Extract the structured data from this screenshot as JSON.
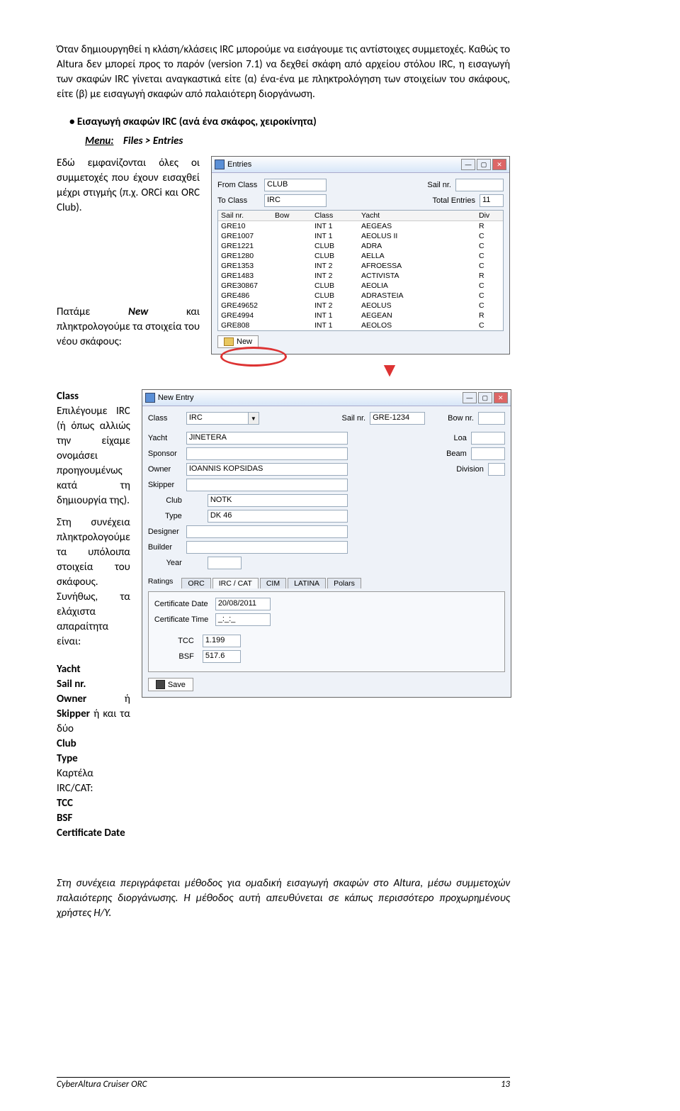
{
  "intro": {
    "p1": "Όταν δημιουργηθεί η κλάση/κλάσεις IRC μπορούμε να εισάγουμε τις αντίστοιχες συμμετοχές. Καθώς το Altura δεν μπορεί προς το παρόν (version 7.1) να δεχθεί σκάφη από αρχείου στόλου IRC, η εισαγωγή των σκαφών IRC γίνεται αναγκαστικά είτε (α) ένα-ένα με πληκτρολόγηση των στοιχείων του σκάφους, είτε (β) με εισαγωγή σκαφών από παλαιότερη διοργάνωση."
  },
  "section": {
    "bullet": "Εισαγωγή σκαφών IRC (ανά ένα σκάφος, χειροκίνητα)",
    "menu_pre": "Menu:",
    "menu_path": "Files > Entries",
    "desc1": "Εδώ εμφανίζονται όλες οι συμμετοχές που έχουν εισαχθεί μέχρι στιγμής (π.χ. ORCi και ORC Club).",
    "desc2_a": "Πατάμε ",
    "desc2_new": "New",
    "desc2_b": " και πληκτρολογούμε τα στοιχεία του νέου  σκάφους:"
  },
  "entries": {
    "title": "Entries",
    "fromclass_lbl": "From Class",
    "fromclass_val": "CLUB",
    "toclass_lbl": "To Class",
    "toclass_val": "IRC",
    "sailnr_lbl": "Sail nr.",
    "totalentries_lbl": "Total Entries",
    "totalentries_val": "11",
    "cols": {
      "c1": "Sail nr.",
      "c2": "Bow",
      "c3": "Class",
      "c4": "Yacht",
      "c5": "Div"
    },
    "rows": [
      {
        "c1": "GRE10",
        "c2": "",
        "c3": "INT 1",
        "c4": "AEGEAS",
        "c5": "R"
      },
      {
        "c1": "GRE1007",
        "c2": "",
        "c3": "INT 1",
        "c4": "AEOLUS II",
        "c5": "C"
      },
      {
        "c1": "GRE1221",
        "c2": "",
        "c3": "CLUB",
        "c4": "ADRA",
        "c5": "C"
      },
      {
        "c1": "GRE1280",
        "c2": "",
        "c3": "CLUB",
        "c4": "AELLA",
        "c5": "C"
      },
      {
        "c1": "GRE1353",
        "c2": "",
        "c3": "INT 2",
        "c4": "AFROESSA",
        "c5": "C"
      },
      {
        "c1": "GRE1483",
        "c2": "",
        "c3": "INT 2",
        "c4": "ACTIVISTA",
        "c5": "R"
      },
      {
        "c1": "GRE30867",
        "c2": "",
        "c3": "CLUB",
        "c4": "AEOLIA",
        "c5": "C"
      },
      {
        "c1": "GRE486",
        "c2": "",
        "c3": "CLUB",
        "c4": "ADRASTEIA",
        "c5": "C"
      },
      {
        "c1": "GRE49652",
        "c2": "",
        "c3": "INT 2",
        "c4": "AEOLUS",
        "c5": "C"
      },
      {
        "c1": "GRE4994",
        "c2": "",
        "c3": "INT 1",
        "c4": "AEGEAN",
        "c5": "R"
      },
      {
        "c1": "GRE808",
        "c2": "",
        "c3": "INT 1",
        "c4": "AEOLOS",
        "c5": "C"
      }
    ],
    "newbtn": "New"
  },
  "mid": {
    "class_h": "Class",
    "class_p": "Επιλέγουμε IRC (ή όπως αλλιώς την είχαμε ονομάσει προηγουμένως κατά τη δημιουργία της).",
    "cont_p": "Στη συνέχεια πληκτρολογούμε τα υπόλοιπα στοιχεία του σκάφους. Συνήθως, τα ελάχιστα απαραίτητα είναι:",
    "list": {
      "yacht": "Yacht",
      "sail": "Sail nr.",
      "owner_a": "Owner",
      "or1": " ή ",
      "skipper": "Skipper",
      "or2": " ή και τα δύο",
      "club": "Club",
      "type": "Type",
      "irccat": "Καρτέλα IRC/CAT:",
      "tcc": "TCC",
      "bsf": "BSF",
      "cdate": "Certificate Date"
    }
  },
  "newentry": {
    "title": "New Entry",
    "class_lbl": "Class",
    "class_val": "IRC",
    "sail_lbl": "Sail nr.",
    "sail_val": "GRE-1234",
    "bow_lbl": "Bow nr.",
    "yacht_lbl": "Yacht",
    "yacht_val": "JINETERA",
    "loa_lbl": "Loa",
    "sponsor_lbl": "Sponsor",
    "beam_lbl": "Beam",
    "owner_lbl": "Owner",
    "owner_val": "IOANNIS KOPSIDAS",
    "div_lbl": "Division",
    "skipper_lbl": "Skipper",
    "club_lbl": "Club",
    "club_val": "NOTK",
    "type_lbl": "Type",
    "type_val": "DK 46",
    "designer_lbl": "Designer",
    "builder_lbl": "Builder",
    "year_lbl": "Year",
    "ratings_lbl": "Ratings",
    "tabs": {
      "orc": "ORC",
      "irc": "IRC / CAT",
      "cim": "CIM",
      "latina": "LATINA",
      "polars": "Polars"
    },
    "cdate_lbl": "Certificate Date",
    "cdate_val": "20/08/2011",
    "ctime_lbl": "Certificate Time",
    "ctime_val": "_:_:_",
    "tcc_lbl": "TCC",
    "tcc_val": "1.199",
    "bsf_lbl": "BSF",
    "bsf_val": "517.6",
    "save": "Save"
  },
  "outro": {
    "p": "Στη συνέχεια περιγράφεται μέθοδος για ομαδική εισαγωγή σκαφών στο Altura, μέσω συμμετοχών παλαιότερης διοργάνωσης. Η μέθοδος αυτή απευθύνεται σε κάπως περισσότερο προχωρημένους χρήστες Η/Υ."
  },
  "footer": {
    "left": "CyberAltura Cruiser ORC",
    "right": "13"
  }
}
